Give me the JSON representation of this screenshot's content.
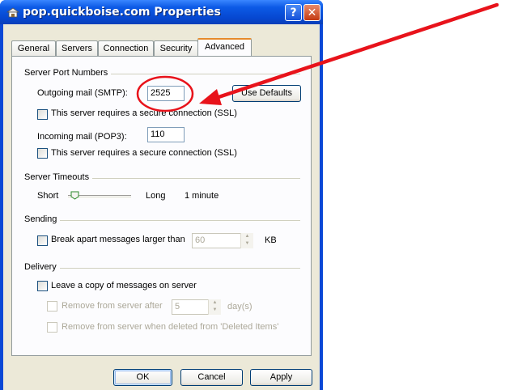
{
  "window": {
    "title": "pop.quickboise.com Properties",
    "help": "?",
    "close": "✕"
  },
  "tabs": [
    {
      "label": "General"
    },
    {
      "label": "Servers"
    },
    {
      "label": "Connection"
    },
    {
      "label": "Security"
    },
    {
      "label": "Advanced"
    }
  ],
  "server_ports": {
    "group": "Server Port Numbers",
    "outgoing_label": "Outgoing mail (SMTP):",
    "outgoing_value": "2525",
    "use_defaults": "Use Defaults",
    "ssl_outgoing": "This server requires a secure connection (SSL)",
    "incoming_label": "Incoming mail (POP3):",
    "incoming_value": "110",
    "ssl_incoming": "This server requires a secure connection (SSL)"
  },
  "timeouts": {
    "group": "Server Timeouts",
    "short": "Short",
    "long": "Long",
    "value": "1 minute",
    "level": 0.1
  },
  "sending": {
    "group": "Sending",
    "break_apart": "Break apart messages larger than",
    "size_value": "60",
    "unit": "KB"
  },
  "delivery": {
    "group": "Delivery",
    "leave_copy": "Leave a copy of messages on server",
    "remove_after": "Remove from server after",
    "days_value": "5",
    "days_unit": "day(s)",
    "remove_deleted": "Remove from server when deleted from 'Deleted Items'"
  },
  "footer": {
    "ok": "OK",
    "cancel": "Cancel",
    "apply": "Apply"
  },
  "annotation": {
    "color": "#e8131b"
  }
}
